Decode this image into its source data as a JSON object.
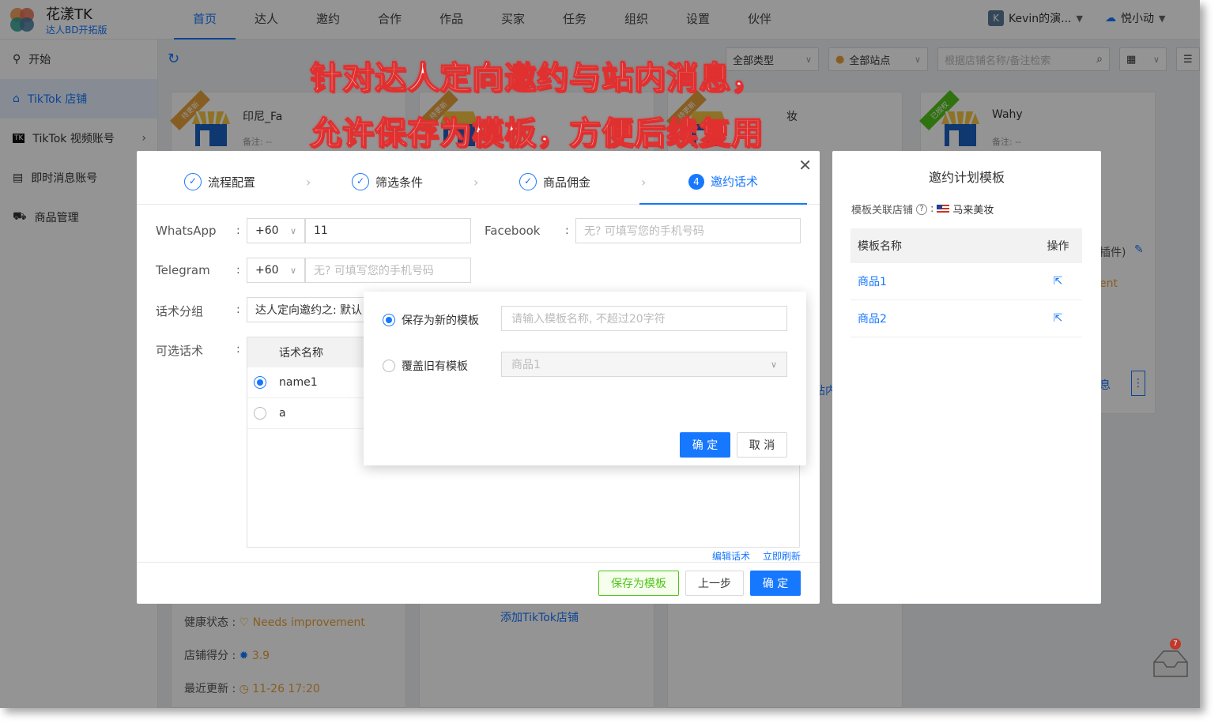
{
  "app": {
    "brand": "花漾TK",
    "subtitle": "达人BD开拓版"
  },
  "nav": [
    {
      "label": "首页",
      "active": true
    },
    {
      "label": "达人"
    },
    {
      "label": "邀约"
    },
    {
      "label": "合作"
    },
    {
      "label": "作品"
    },
    {
      "label": "买家"
    },
    {
      "label": "任务"
    },
    {
      "label": "组织"
    },
    {
      "label": "设置"
    },
    {
      "label": "伙伴"
    }
  ],
  "account": {
    "initial": "K",
    "name": "Kevin的演...",
    "user": "悦小动"
  },
  "sidebar": [
    {
      "label": "开始",
      "icon": "rocket-icon"
    },
    {
      "label": "TikTok 店铺",
      "icon": "shop-icon",
      "active": true
    },
    {
      "label": "TikTok 视频账号",
      "icon": "tiktok-icon",
      "has_arrow": true
    },
    {
      "label": "即时消息账号",
      "icon": "message-icon"
    },
    {
      "label": "商品管理",
      "icon": "cart-icon"
    }
  ],
  "filters": {
    "type": "全部类型",
    "site": "全部站点",
    "search_placeholder": "根据店铺名称/备注检索"
  },
  "cards": [
    {
      "tag": "待更新",
      "tag_color": "#e9a23b",
      "name": "印尼_Fa",
      "note": "备注: --"
    },
    {
      "tag": "待更新",
      "tag_color": "#e9a23b",
      "name": "",
      "note": ""
    },
    {
      "tag": "待更新",
      "tag_color": "#e9a23b",
      "name": "妆",
      "note": ""
    },
    {
      "tag": "已授权",
      "tag_color": "#52c41a",
      "name": "Wahy",
      "note": "备注: --"
    }
  ],
  "card_bottom": {
    "health_label": "健康状态 :",
    "health_value": "Needs improvement",
    "score_label": "店铺得分 :",
    "score_value": "3.9",
    "update_label": "最近更新 :",
    "update_value": "11-26 17:20",
    "add_link": "添加TikTok店铺"
  },
  "peek": {
    "p1": "插件)",
    "p2": "ent",
    "p3": "站内",
    "p4": "息"
  },
  "wizard": {
    "steps": [
      {
        "label": "流程配置",
        "done": true
      },
      {
        "label": "筛选条件",
        "done": true
      },
      {
        "label": "商品佣金",
        "done": true
      },
      {
        "label": "邀约话术",
        "num": "4",
        "active": true
      }
    ],
    "fields": {
      "whatsapp_label": "WhatsApp",
      "whatsapp_code": "+60",
      "whatsapp_value": "11",
      "facebook_label": "Facebook",
      "facebook_placeholder": "无? 可填写您的手机号码",
      "telegram_label": "Telegram",
      "telegram_code": "+60",
      "telegram_placeholder": "无? 可填写您的手机号码",
      "group_label": "话术分组",
      "group_value": "达人定向邀约之: 默认",
      "options_label": "可选话术",
      "colon": ":"
    },
    "table": {
      "header": "话术名称",
      "rows": [
        {
          "name": "name1",
          "selected": true
        },
        {
          "name": "a",
          "selected": false
        }
      ]
    },
    "links": {
      "edit": "编辑话术",
      "refresh": "立即刷新"
    },
    "buttons": {
      "save_template": "保存为模板",
      "prev": "上一步",
      "confirm": "确 定"
    }
  },
  "template_panel": {
    "title": "邀约计划模板",
    "shop_label": "模板关联店铺",
    "shop_value": "马来美妆",
    "col_name": "模板名称",
    "col_action": "操作",
    "rows": [
      {
        "name": "商品1"
      },
      {
        "name": "商品2"
      }
    ]
  },
  "save_modal": {
    "opt_new": "保存为新的模板",
    "new_placeholder": "请输入模板名称, 不超过20字符",
    "opt_overwrite": "覆盖旧有模板",
    "overwrite_value": "商品1",
    "confirm": "确 定",
    "cancel": "取 消"
  },
  "caption": {
    "line1": "针对达人定向邀约与站内消息，",
    "line2": "允许保存为模板，方便后续复用"
  },
  "notification_count": "7",
  "colors": {
    "primary": "#1677ff",
    "success": "#52c41a",
    "warning": "#e9a23b",
    "caption": "#e03030"
  }
}
